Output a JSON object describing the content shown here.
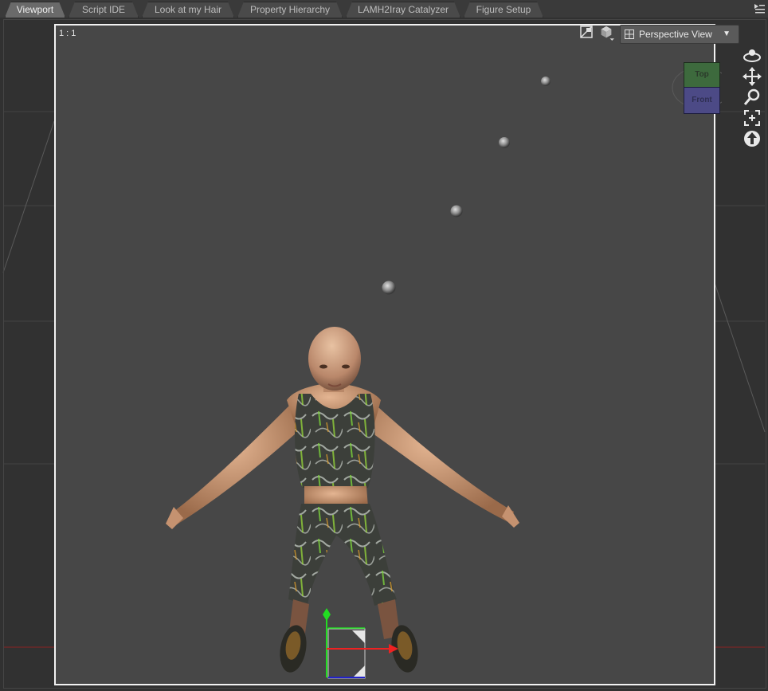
{
  "tabs": [
    {
      "label": "Viewport",
      "active": true
    },
    {
      "label": "Script IDE",
      "active": false
    },
    {
      "label": "Look at my Hair",
      "active": false
    },
    {
      "label": "Property Hierarchy",
      "active": false
    },
    {
      "label": "LAMH2Iray Catalyzer",
      "active": false
    },
    {
      "label": "Figure Setup",
      "active": false
    }
  ],
  "viewport": {
    "scale_label": "1 : 1",
    "view_select": {
      "value": "Perspective View",
      "icon": "grid-icon"
    },
    "nav_cube": {
      "top_label": "Top",
      "front_label": "Front"
    },
    "top_icons": [
      "render-preview-icon",
      "draw-style-icon"
    ],
    "tools": [
      "orbit-icon",
      "pan-icon",
      "zoom-icon",
      "frame-icon",
      "reset-camera-icon"
    ]
  },
  "colors": {
    "canvas_bg": "#474747",
    "canvas_border": "#f2f2f2",
    "active_tab": "#6a6a6a",
    "gizmo_y": "#22dd22",
    "gizmo_x": "#ee2222",
    "gizmo_z": "#2222cc"
  }
}
